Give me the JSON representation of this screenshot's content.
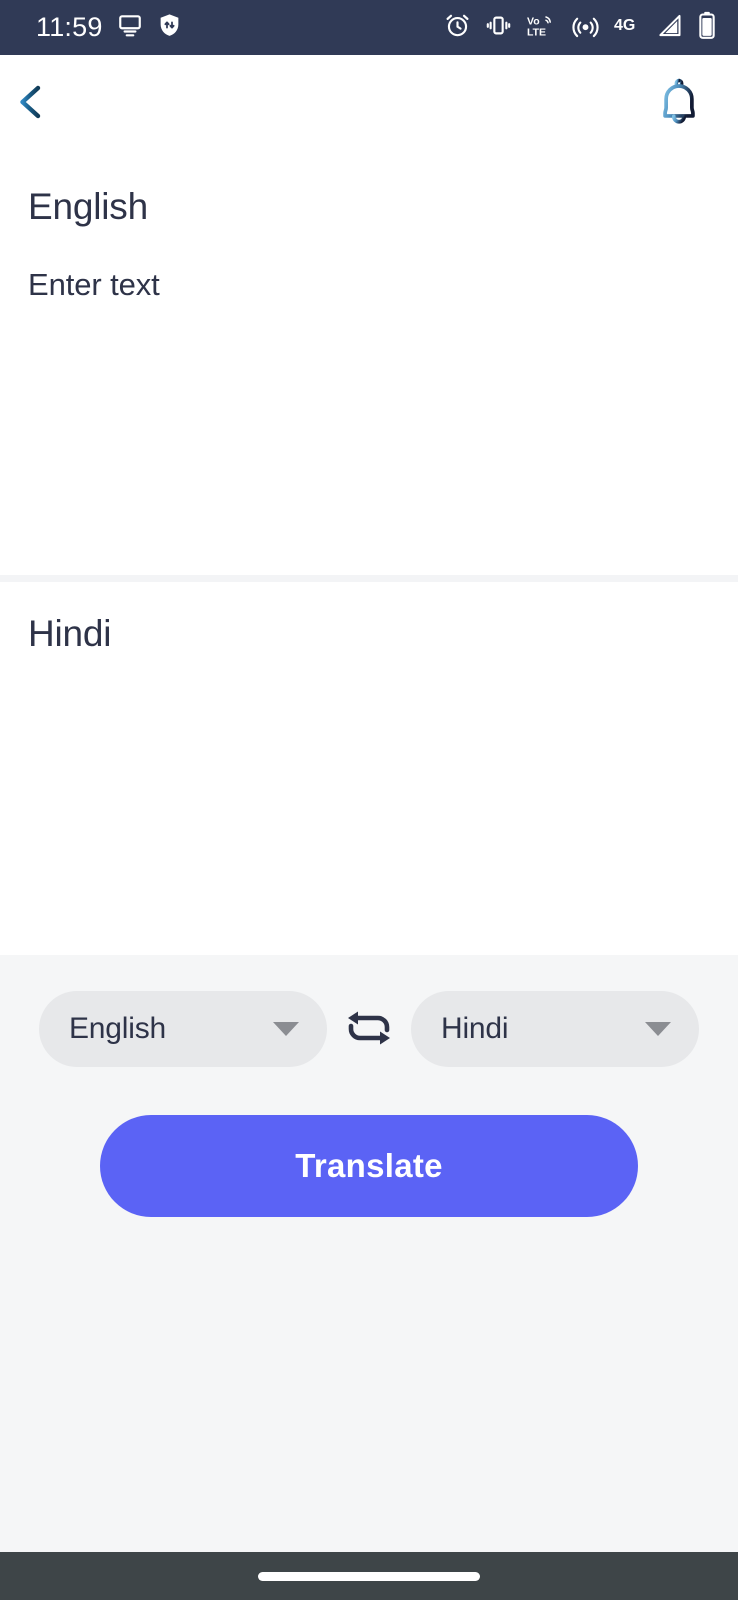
{
  "status_bar": {
    "time": "11:59",
    "background_color": "#303A56",
    "left_icons": [
      "cast-icon",
      "vpn-shield-icon"
    ],
    "right_icons": [
      "alarm-icon",
      "vibrate-icon",
      "volte-icon",
      "hotspot-icon",
      "network-4g-icon",
      "signal-icon",
      "battery-icon"
    ],
    "network_label": "4G",
    "volte_label_top": "Vo",
    "volte_label_bottom": "LTE"
  },
  "app_bar": {
    "back_icon": "arrow-left-icon",
    "back_color": "#14527E",
    "notification_icon": "bell-icon",
    "bell_color": "#5EA8D6"
  },
  "source_panel": {
    "language": "English",
    "input_placeholder": "Enter text",
    "input_value": ""
  },
  "target_panel": {
    "language": "Hindi",
    "output_value": ""
  },
  "controls": {
    "source_dropdown": {
      "selected": "English",
      "caret_icon": "chevron-down-icon"
    },
    "swap_icon": "swap-languages-icon",
    "target_dropdown": {
      "selected": "Hindi",
      "caret_icon": "chevron-down-icon"
    },
    "translate_label": "Translate",
    "translate_color": "#5B63F5",
    "panel_background": "#F5F6F7"
  },
  "nav_bar": {
    "handle": "home-gesture-handle",
    "background_color": "#3E4548"
  },
  "theme": {
    "text_dark": "#2E3348",
    "pill_background": "#E7E8EA",
    "divider": "#F3F4F6"
  }
}
